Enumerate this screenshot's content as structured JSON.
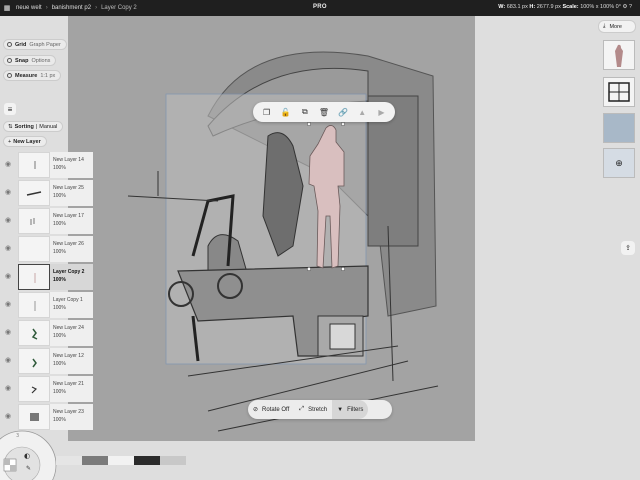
{
  "topbar": {
    "grid_icon": "grid-icon",
    "crumbs": [
      "neue welt",
      "banishment p2",
      "Layer Copy 2"
    ],
    "separator": "›",
    "pro_label": "PRO",
    "dims": "683.1 px",
    "dims_w_label": "W:",
    "dims_h_label": "H:",
    "dims_h": "2677.9 px",
    "scale_label": "Scale:",
    "scale": "100% x 100%",
    "rotation": "0°",
    "settings_icon": "gear-icon",
    "help_icon": "help-icon"
  },
  "canvas_toggles": [
    {
      "label": "Grid",
      "sub": "Graph Paper"
    },
    {
      "label": "Snap",
      "sub": "Options"
    },
    {
      "label": "Measure",
      "sub": "1:1 px"
    }
  ],
  "layers_panel": {
    "sort_label": "Sorting",
    "sort_mode": "Manual",
    "new_layer": "New Layer",
    "rows": [
      {
        "name": "New Layer 14",
        "opacity": "100%"
      },
      {
        "name": "New Layer 25",
        "opacity": "100%"
      },
      {
        "name": "New Layer 17",
        "opacity": "100%"
      },
      {
        "name": "New Layer 26",
        "opacity": "100%"
      },
      {
        "name": "Layer Copy 2",
        "opacity": "100%",
        "active": true
      },
      {
        "name": "Layer Copy 1",
        "opacity": "100%"
      },
      {
        "name": "New Layer 24",
        "opacity": "100%"
      },
      {
        "name": "New Layer 12",
        "opacity": "100%"
      },
      {
        "name": "New Layer 21",
        "opacity": "100%"
      },
      {
        "name": "New Layer 23",
        "opacity": "100%"
      }
    ]
  },
  "float_toolbar": [
    "duplicate-icon",
    "unlock-icon",
    "copy-icon",
    "trash-icon",
    "link-icon",
    "flip-vertical-icon",
    "flip-horizontal-icon"
  ],
  "bottom_toolbar": {
    "rotate": "Rotate Off",
    "stretch": "Stretch",
    "filters": "Filters"
  },
  "right_panel": {
    "more_label": "More"
  },
  "colors": {
    "canvas_bg": "#a3a3a3",
    "paper": "#c9c9c9",
    "figure_pink": "#d9bfbf",
    "swatch1": "#e5e5e5",
    "swatch2": "#7b7b7b",
    "swatch3": "#f2f2f2",
    "swatch4": "#2b2b2b",
    "swatch5": "#c8c8c8"
  },
  "wheel": {
    "size_value": "3"
  }
}
